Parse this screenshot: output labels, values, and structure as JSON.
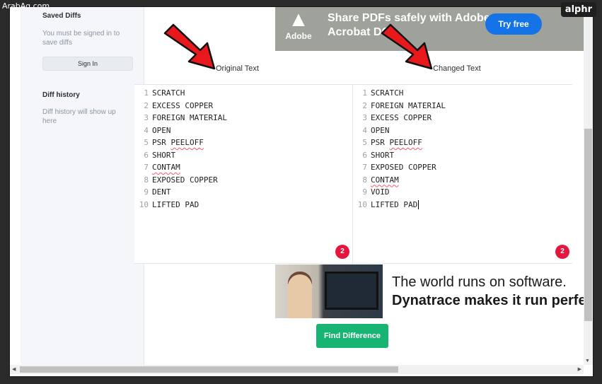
{
  "watermark": "ArabAq.com",
  "brand": "alphr",
  "sidebar": {
    "saved_heading": "Saved Diffs",
    "saved_note": "You must be signed in to save diffs",
    "signin_label": "Sign In",
    "history_heading": "Diff history",
    "history_note": "Diff history will show up here"
  },
  "ad_top": {
    "logo_word": "Adobe",
    "text": "Share PDFs safely with Adobe Acrobat DC.",
    "cta": "Try free"
  },
  "panels": {
    "original_label": "Original Text",
    "changed_label": "Changed Text",
    "original_badge": "2",
    "changed_badge": "2"
  },
  "original_lines": [
    "SCRATCH",
    "EXCESS COPPER",
    "FOREIGN MATERIAL",
    "OPEN",
    "PSR PEELOFF",
    "SHORT",
    "CONTAM",
    "EXPOSED COPPER",
    "DENT",
    "LIFTED PAD"
  ],
  "changed_lines": [
    "SCRATCH",
    "FOREIGN MATERIAL",
    "EXCESS COPPER",
    "OPEN",
    "PSR PEELOFF",
    "SHORT",
    "EXPOSED COPPER",
    "CONTAM",
    "VOID",
    "LIFTED PAD"
  ],
  "ad_bottom": {
    "line1": "The world runs on software.",
    "line2": "Dynatrace makes it run perfe"
  },
  "find_button": "Find Difference",
  "colors": {
    "accent_green": "#17b473",
    "badge_red": "#e3173e",
    "adobe_blue": "#1473e6",
    "arrow_red": "#e8191d"
  }
}
